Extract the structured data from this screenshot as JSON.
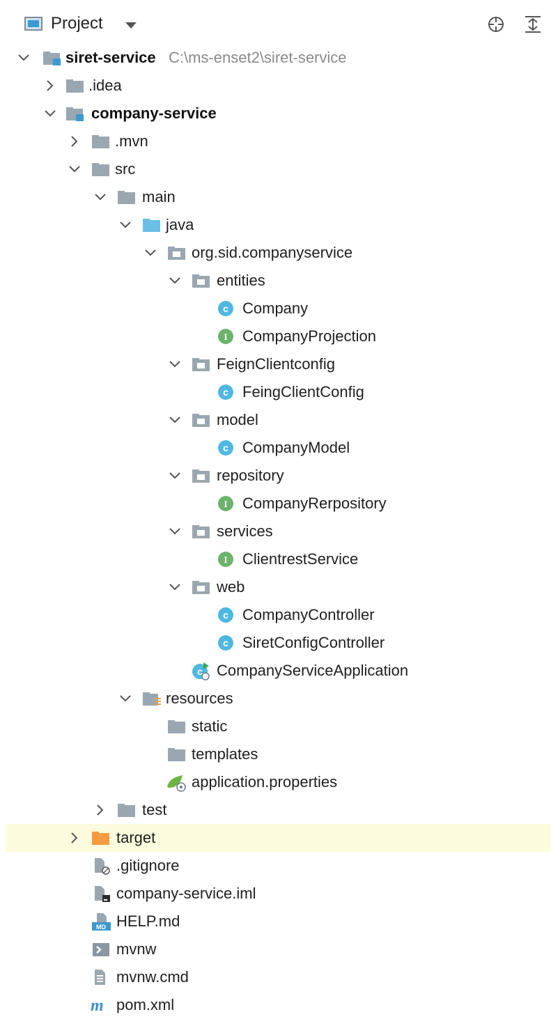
{
  "toolbar": {
    "title": "Project",
    "buttons": [
      "locate-icon",
      "collapse-all-icon"
    ]
  },
  "colors": {
    "folder": "#9aa7b0",
    "source_folder": "#6bbfe6",
    "excluded_folder": "#f59c42",
    "class_icon": "#4fb8e0",
    "interface_icon": "#6cb36b",
    "highlight": "#fdfbdd"
  },
  "tree": {
    "root": {
      "name": "siret-service",
      "path": "C:\\ms-enset2\\siret-service"
    },
    "idea": ".idea",
    "company_service": "company-service",
    "mvn": ".mvn",
    "src": "src",
    "main": "main",
    "java": "java",
    "package": "org.sid.companyservice",
    "entities": "entities",
    "company": "Company",
    "company_projection": "CompanyProjection",
    "feign_pkg": "FeignClientconfig",
    "feign_class": "FeingClientConfig",
    "model_pkg": "model",
    "company_model": "CompanyModel",
    "repository_pkg": "repository",
    "company_repository": "CompanyRerpository",
    "services_pkg": "services",
    "clientrest_service": "ClientrestService",
    "web_pkg": "web",
    "company_controller": "CompanyController",
    "siret_config_controller": "SiretConfigController",
    "app_class": "CompanyServiceApplication",
    "resources": "resources",
    "static": "static",
    "templates": "templates",
    "app_properties": "application.properties",
    "test": "test",
    "target": "target",
    "gitignore": ".gitignore",
    "iml": "company-service.iml",
    "help": "HELP.md",
    "mvnw": "mvnw",
    "mvnw_cmd": "mvnw.cmd",
    "pom": "pom.xml"
  }
}
